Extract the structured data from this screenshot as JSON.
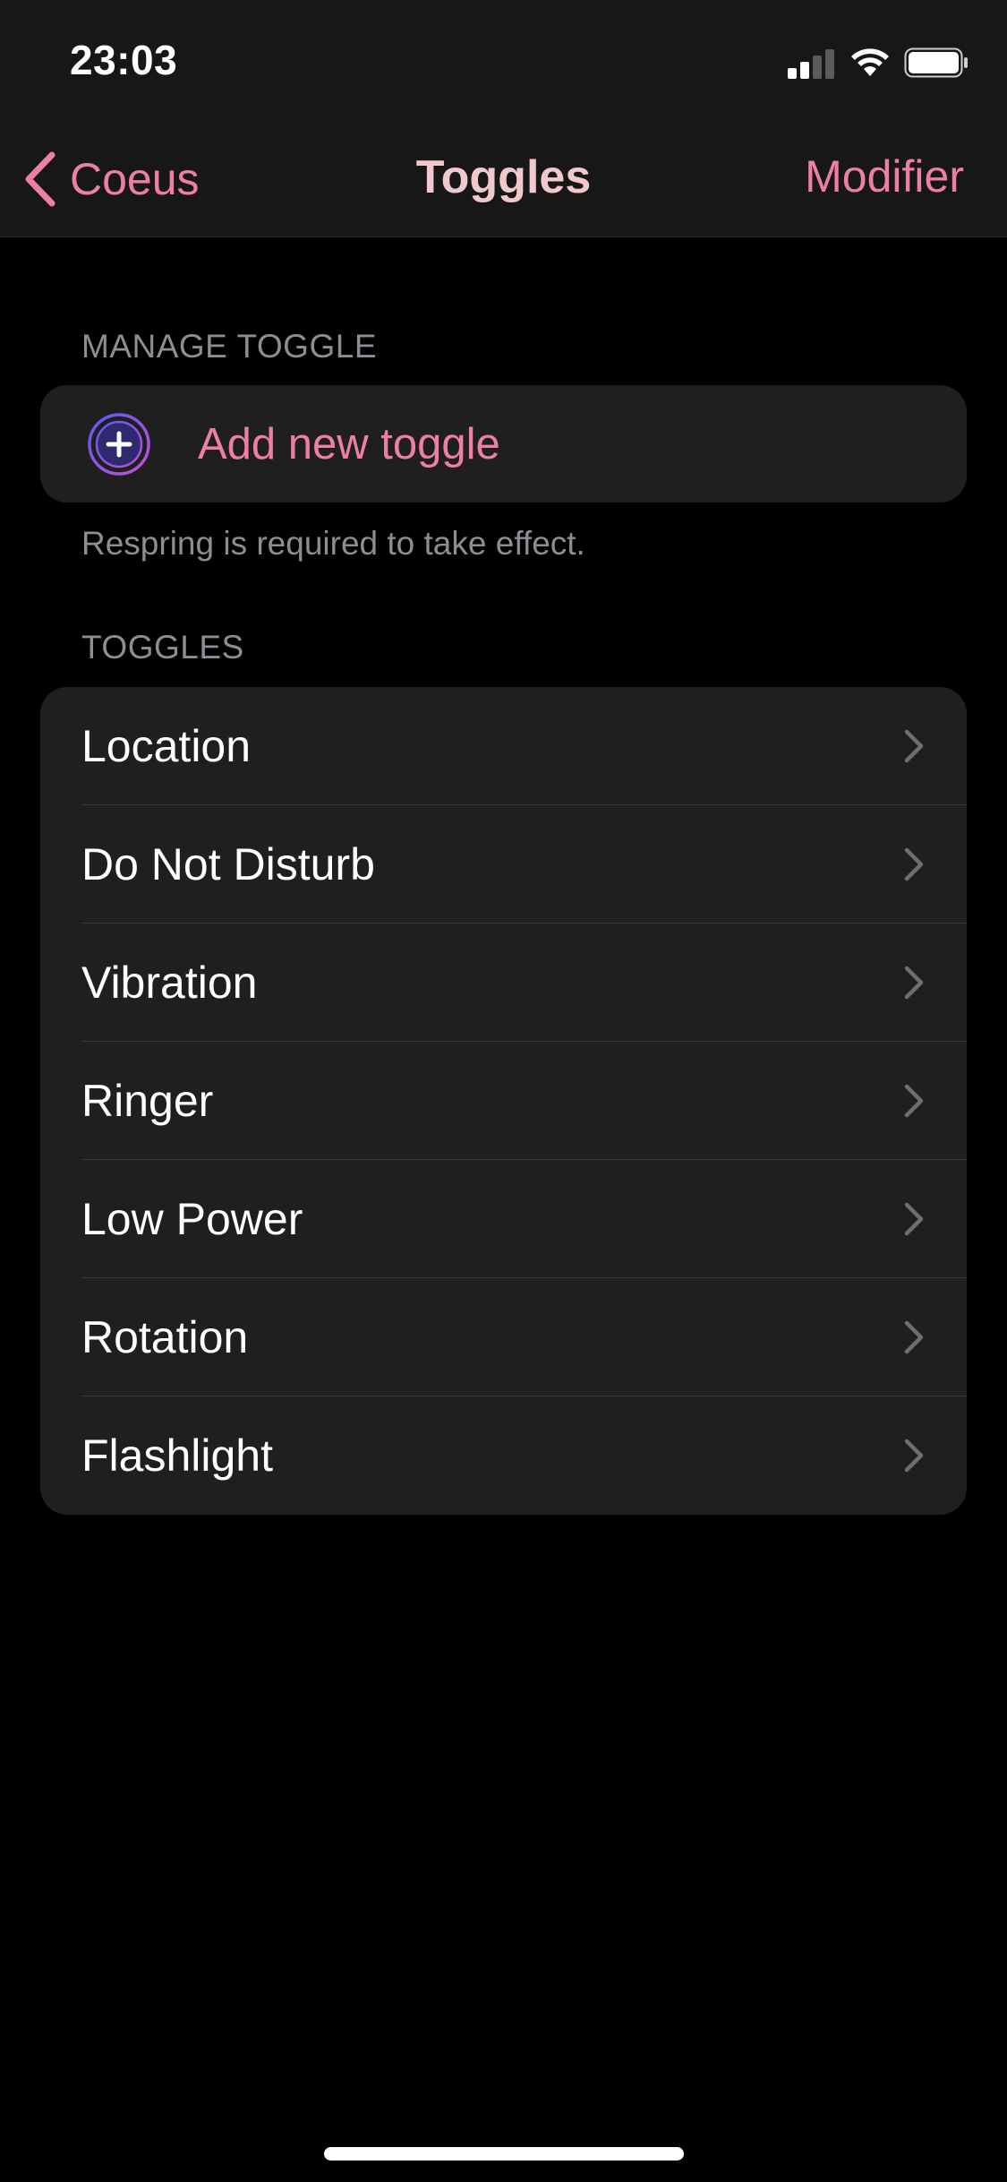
{
  "status_bar": {
    "time": "23:03",
    "icons": [
      "cellular-signal-icon",
      "wifi-icon",
      "battery-icon"
    ]
  },
  "nav_bar": {
    "back_label": "Coeus",
    "title": "Toggles",
    "action_label": "Modifier"
  },
  "manage_section": {
    "header": "MANAGE TOGGLE",
    "add_label": "Add new toggle",
    "add_icon": "plus-circle-icon",
    "footer": "Respring is required to take effect."
  },
  "toggles_section": {
    "header": "TOGGLES",
    "items": [
      {
        "label": "Location"
      },
      {
        "label": "Do Not Disturb"
      },
      {
        "label": "Vibration"
      },
      {
        "label": "Ringer"
      },
      {
        "label": "Low Power"
      },
      {
        "label": "Rotation"
      },
      {
        "label": "Flashlight"
      }
    ]
  },
  "colors": {
    "accent": "#ee7fa4",
    "title": "#f2c8cf",
    "background": "#000000",
    "header_background": "#171717",
    "cell_background": "#1f1f1f",
    "secondary_text": "#8d8d93"
  }
}
